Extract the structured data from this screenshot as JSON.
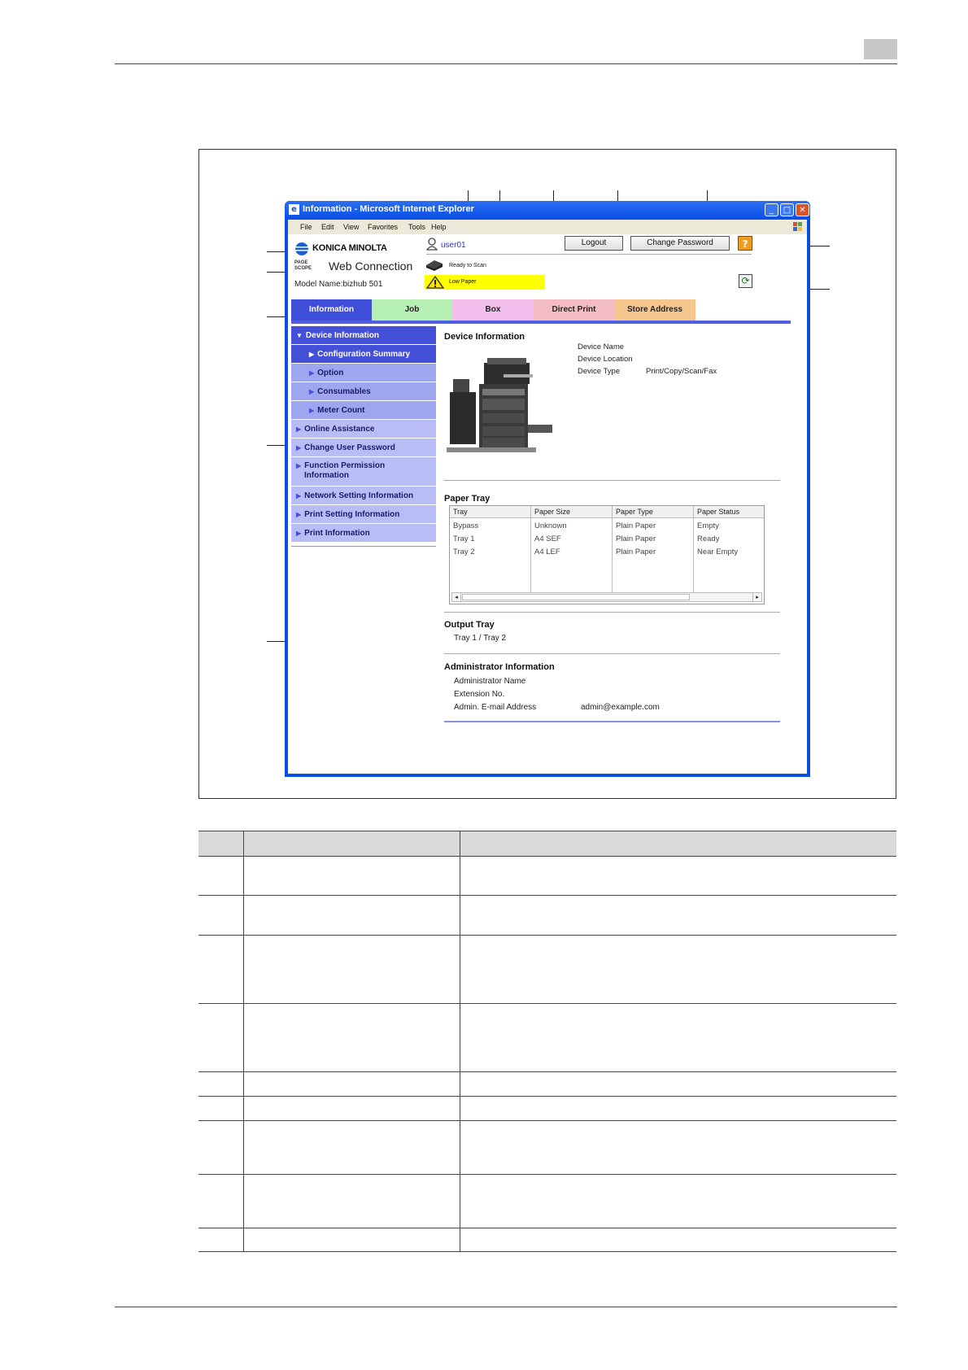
{
  "window": {
    "title": "Information - Microsoft Internet Explorer",
    "menu": [
      "File",
      "Edit",
      "View",
      "Favorites",
      "Tools",
      "Help"
    ]
  },
  "header": {
    "brand": "KONICA MINOLTA",
    "product_page": "PAGE",
    "product_scope": "SCOPE",
    "product": "Web Connection",
    "model": "Model Name:bizhub 501",
    "user": "user01",
    "status": "Ready to Scan",
    "alert": "Low Paper",
    "logout": "Logout",
    "change_password": "Change Password",
    "help": "?"
  },
  "tabs": [
    {
      "label": "Information",
      "color": "#3f4ed8"
    },
    {
      "label": "Job",
      "color": "#b7f0b3"
    },
    {
      "label": "Box",
      "color": "#f3c0ee"
    },
    {
      "label": "Direct Print",
      "color": "#f4bcc4"
    },
    {
      "label": "Store Address",
      "color": "#f5c78f"
    }
  ],
  "sidebar": {
    "items": [
      {
        "label": "Device Information"
      },
      {
        "label": "Configuration Summary"
      },
      {
        "label": "Option"
      },
      {
        "label": "Consumables"
      },
      {
        "label": "Meter Count"
      },
      {
        "label": "Online Assistance"
      },
      {
        "label": "Change User Password"
      },
      {
        "label": "Function Permission Information"
      },
      {
        "label": "Network Setting Information"
      },
      {
        "label": "Print Setting Information"
      },
      {
        "label": "Print Information"
      }
    ]
  },
  "device": {
    "title": "Device Information",
    "name_label": "Device Name",
    "location_label": "Device Location",
    "type_label": "Device Type",
    "type_value": "Print/Copy/Scan/Fax"
  },
  "paper_tray": {
    "title": "Paper Tray",
    "headers": [
      "Tray",
      "Paper Size",
      "Paper Type",
      "Paper Status"
    ],
    "rows": [
      [
        "Bypass",
        "Unknown",
        "Plain Paper",
        "Empty"
      ],
      [
        "Tray 1",
        "A4 SEF",
        "Plain Paper",
        "Ready"
      ],
      [
        "Tray 2",
        "A4 LEF",
        "Plain Paper",
        "Near Empty"
      ]
    ]
  },
  "output_tray": {
    "title": "Output Tray",
    "value": "Tray 1 / Tray 2"
  },
  "admin": {
    "title": "Administrator Information",
    "name_label": "Administrator Name",
    "extension_label": "Extension No.",
    "email_label": "Admin. E-mail Address",
    "email_value": "admin@example.com"
  }
}
